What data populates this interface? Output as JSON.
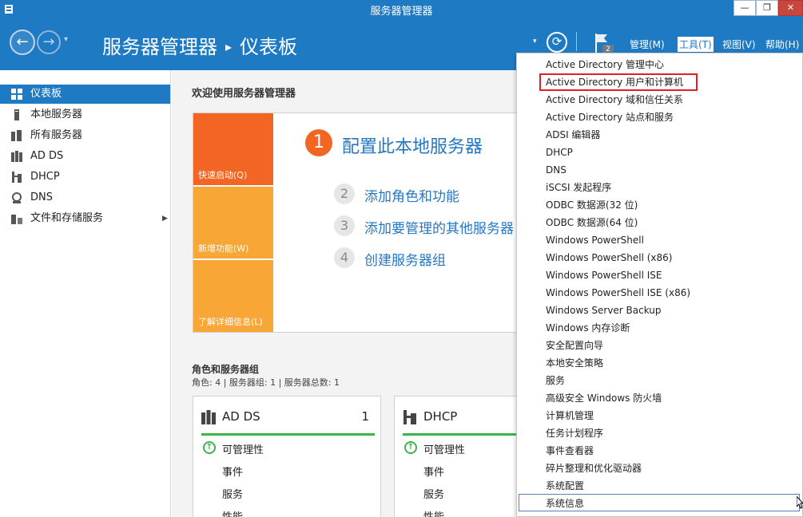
{
  "window": {
    "title": "服务器管理器",
    "min_label": "—",
    "max_label": "❐",
    "close_label": "✕"
  },
  "header": {
    "back_label": "←",
    "forward_label": "→",
    "dropdown_glyph": "▾",
    "breadcrumb_root": "服务器管理器",
    "breadcrumb_sep": "▸",
    "breadcrumb_current": "仪表板",
    "refresh_glyph": "⟳",
    "flag_badge": "2",
    "menus": [
      {
        "label": "管理(M)"
      },
      {
        "label": "工具(T)"
      },
      {
        "label": "视图(V)"
      },
      {
        "label": "帮助(H)"
      }
    ]
  },
  "sidebar": {
    "items": [
      {
        "label": "仪表板",
        "icon": "dashboard-icon"
      },
      {
        "label": "本地服务器",
        "icon": "server-icon"
      },
      {
        "label": "所有服务器",
        "icon": "servers-icon"
      },
      {
        "label": "AD DS",
        "icon": "adds-icon"
      },
      {
        "label": "DHCP",
        "icon": "dhcp-icon"
      },
      {
        "label": "DNS",
        "icon": "dns-icon"
      },
      {
        "label": "文件和存储服务",
        "icon": "storage-icon"
      }
    ],
    "expand_glyph": "▶"
  },
  "main": {
    "welcome": "欢迎使用服务器管理器",
    "tiles": [
      "快速启动(Q)",
      "新增功能(W)",
      "了解详细信息(L)"
    ],
    "steps": [
      {
        "num": "1",
        "label": "配置此本地服务器"
      },
      {
        "num": "2",
        "label": "添加角色和功能"
      },
      {
        "num": "3",
        "label": "添加要管理的其他服务器"
      },
      {
        "num": "4",
        "label": "创建服务器组"
      }
    ],
    "roles_title": "角色和服务器组",
    "roles_sub": "角色: 4 | 服务器组: 1 | 服务器总数: 1",
    "cards": [
      {
        "title": "AD DS",
        "count": "1",
        "ok_glyph": "↑",
        "rows": [
          "可管理性",
          "事件",
          "服务",
          "性能"
        ]
      },
      {
        "title": "DHCP",
        "count": "",
        "ok_glyph": "↑",
        "rows": [
          "可管理性",
          "事件",
          "服务",
          "性能"
        ]
      }
    ]
  },
  "tools_menu": {
    "items": [
      "Active Directory 管理中心",
      "Active Directory 用户和计算机",
      "Active Directory 域和信任关系",
      "Active Directory 站点和服务",
      "ADSI 编辑器",
      "DHCP",
      "DNS",
      "iSCSI 发起程序",
      "ODBC 数据源(32 位)",
      "ODBC 数据源(64 位)",
      "Windows PowerShell",
      "Windows PowerShell (x86)",
      "Windows PowerShell ISE",
      "Windows PowerShell ISE (x86)",
      "Windows Server Backup",
      "Windows 内存诊断",
      "安全配置向导",
      "本地安全策略",
      "服务",
      "高级安全 Windows 防火墙",
      "计算机管理",
      "任务计划程序",
      "事件查看器",
      "碎片整理和优化驱动器",
      "系统配置",
      "系统信息"
    ],
    "highlight_color": "#e02020"
  },
  "colors": {
    "accent": "#1f7ac4",
    "tile_primary": "#f26522",
    "tile_secondary": "#f8a635",
    "link": "#2677c2",
    "status_ok": "#3bb54a"
  }
}
